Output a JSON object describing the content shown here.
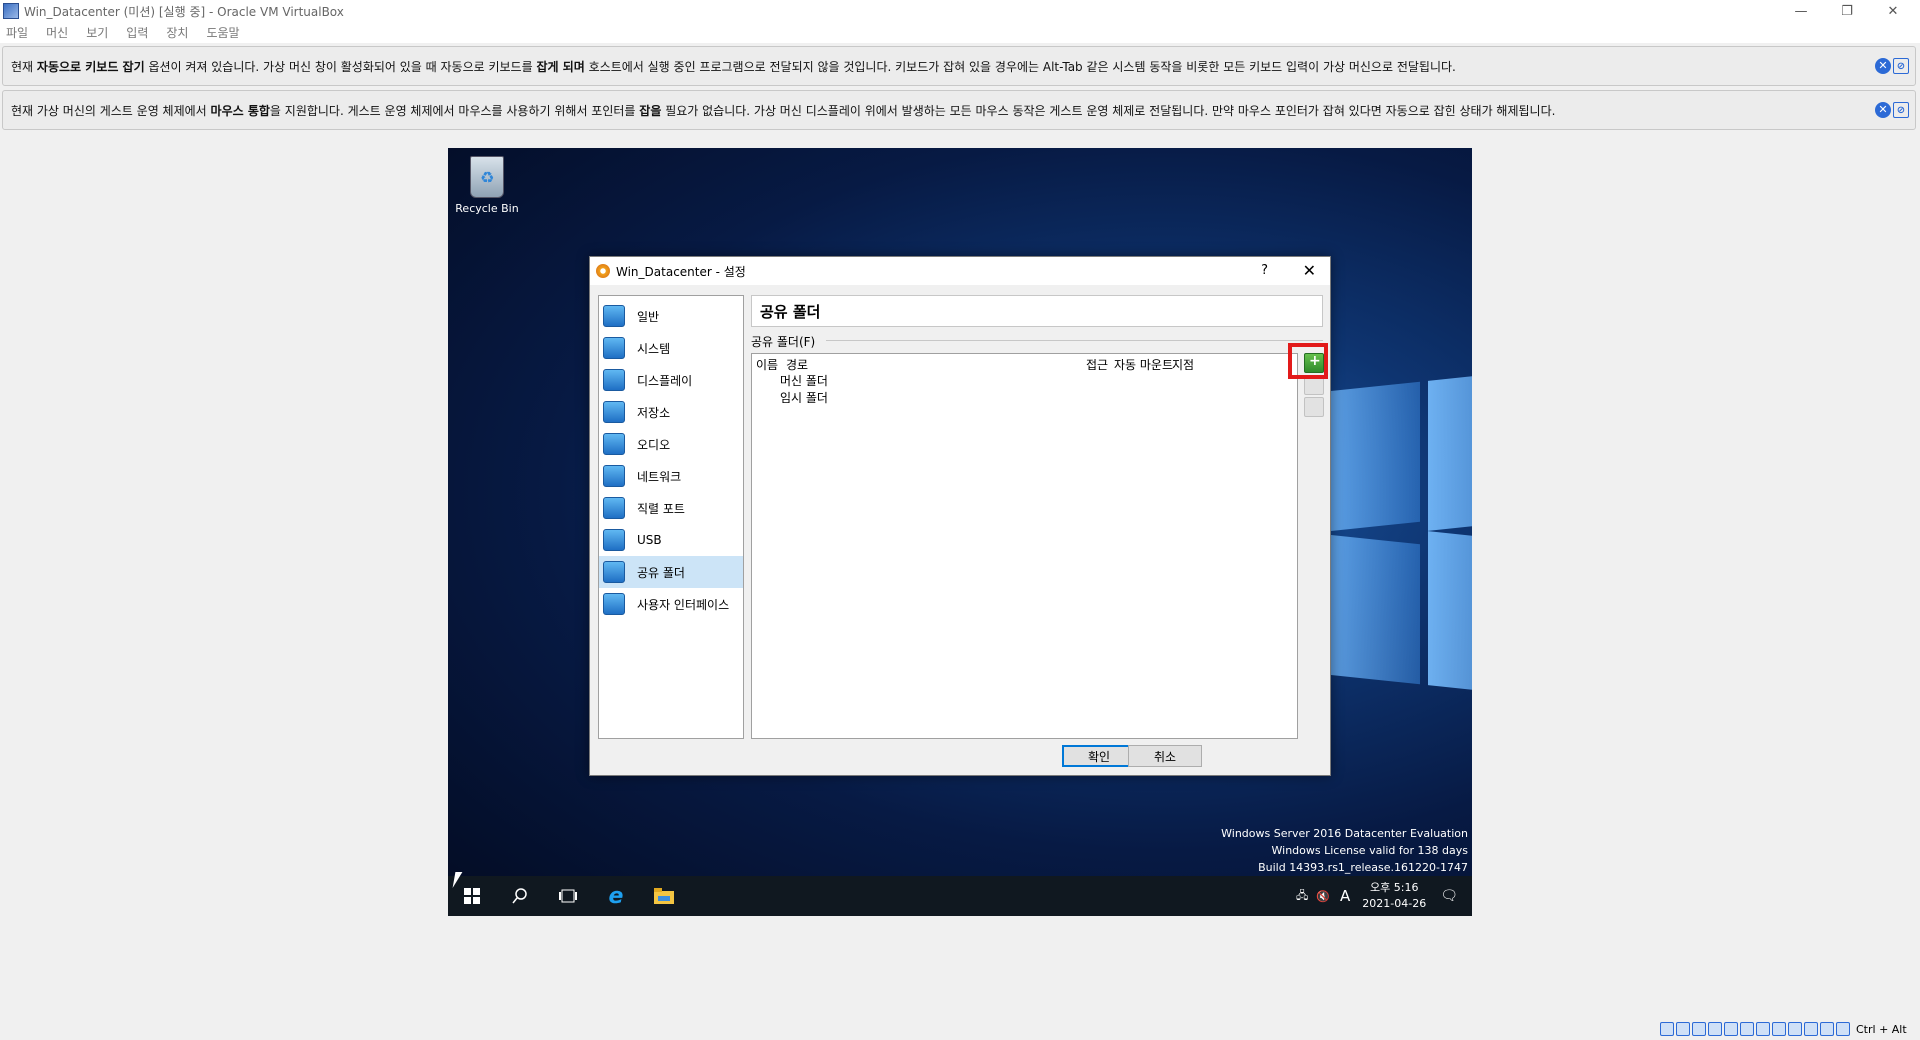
{
  "host": {
    "window_title": "Win_Datacenter (미션) [실행 중] - Oracle VM VirtualBox",
    "menu": [
      "파일",
      "머신",
      "보기",
      "입력",
      "장치",
      "도움말"
    ],
    "controls": {
      "minimize": "—",
      "restore": "❐",
      "close": "✕"
    }
  },
  "notices": [
    {
      "pre": "현재 ",
      "b1": "자동으로 키보드 잡기",
      "mid1": " 옵션이 켜져 있습니다. 가상 머신 창이 활성화되어 있을 때 자동으로 키보드를 ",
      "b2": "잡게 되며",
      "post": " 호스트에서 실행 중인 프로그램으로 전달되지 않을 것입니다. 키보드가 잡혀 있을 경우에는 Alt-Tab 같은 시스템 동작을 비롯한 모든 키보드 입력이 가상 머신으로 전달됩니다."
    },
    {
      "pre": "현재 가상 머신의 게스트 운영 체제에서 ",
      "b1": "마우스 통합",
      "mid1": "을 지원합니다. 게스트 운영 체제에서 마우스를 사용하기 위해서 포인터를 ",
      "b2": "잡을",
      "post": " 필요가 없습니다. 가상 머신 디스플레이 위에서 발생하는 모든 마우스 동작은 게스트 운영 체제로 전달됩니다. 만약 마우스 포인터가 잡혀 있다면 자동으로 잡힌 상태가 해제됩니다."
    }
  ],
  "desktop": {
    "recycle_bin": "Recycle Bin",
    "watermark": [
      "Windows Server 2016 Datacenter Evaluation",
      "Windows License valid for 138 days",
      "Build 14393.rs1_release.161220-1747"
    ],
    "clock_time": "오후 5:16",
    "clock_date": "2021-04-26",
    "ime": "A"
  },
  "dialog": {
    "title": "Win_Datacenter - 설정",
    "help": "?",
    "close": "✕",
    "categories": [
      "일반",
      "시스템",
      "디스플레이",
      "저장소",
      "오디오",
      "네트워크",
      "직렬 포트",
      "USB",
      "공유 폴더",
      "사용자 인터페이스"
    ],
    "selected_category": "공유 폴더",
    "page_title": "공유 폴더",
    "group_label": "공유 폴더(F)",
    "columns": {
      "name": "이름",
      "path": "경로",
      "access": "접근",
      "automount": "자동 마운트",
      "at": "지점"
    },
    "rows": [
      "머신 폴더",
      "임시 폴더"
    ],
    "ok": "확인",
    "cancel": "취소"
  },
  "statusbar": {
    "hostkey": "Ctrl + Alt"
  }
}
